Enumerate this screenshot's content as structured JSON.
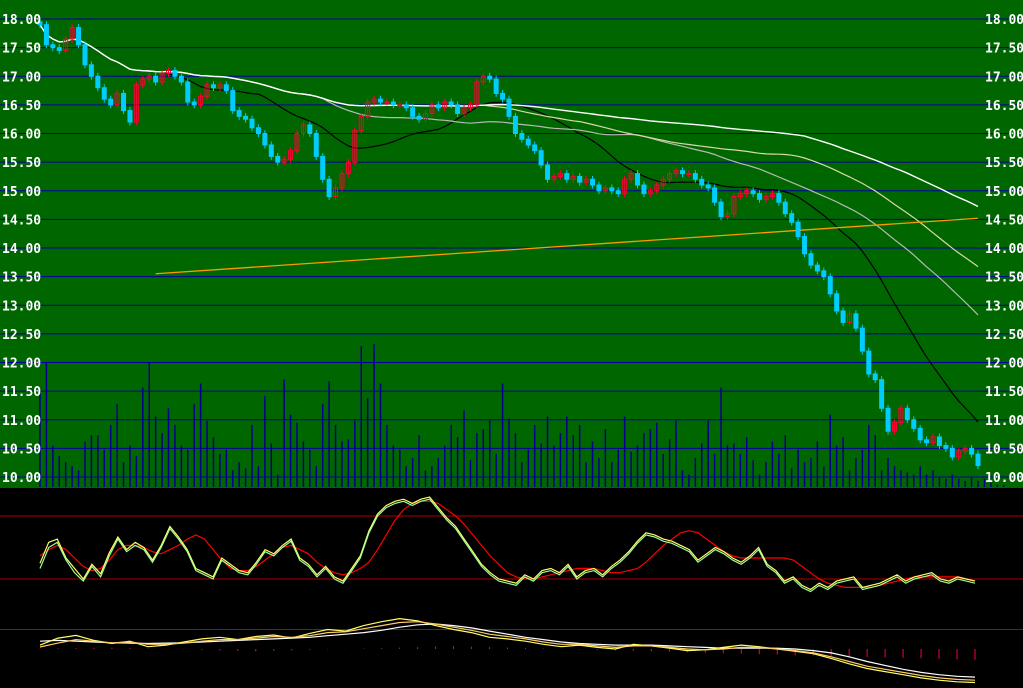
{
  "colors": {
    "main_background": "#006600",
    "indicator_background": "#000000",
    "grid": "#0000a0",
    "axis_text": "#ffffff",
    "up_candle": "#ff0033",
    "down_candle": "#00ccff",
    "volume": "#000088",
    "ma_white": "#ffffff",
    "ma_black": "#000000",
    "ma_pale": "#d8d8a8",
    "ma_grey": "#b8b8b8",
    "trend_orange": "#ff9900",
    "box_magenta": "#ff00aa",
    "box_yellow": "#ffff00",
    "kdj_red": "#ff0000",
    "kdj_yellow": "#ffff66",
    "kdj_green": "#99ff99",
    "ref_line": "#b00000"
  },
  "chart_data": [
    {
      "type": "candlestick",
      "title": "",
      "ylim": [
        10.0,
        18.0
      ],
      "grid": true,
      "y_ticks": [
        "18.00",
        "17.50",
        "17.00",
        "16.50",
        "16.00",
        "15.50",
        "15.00",
        "14.50",
        "14.00",
        "13.50",
        "13.00",
        "12.50",
        "12.00",
        "11.50",
        "11.00",
        "10.50",
        "10.00"
      ],
      "close": [
        17.9,
        17.55,
        17.5,
        17.45,
        17.65,
        17.85,
        17.55,
        17.2,
        17.0,
        16.8,
        16.6,
        16.5,
        16.7,
        16.4,
        16.2,
        16.85,
        16.95,
        17.0,
        16.9,
        17.05,
        17.1,
        17.0,
        16.9,
        16.55,
        16.5,
        16.65,
        16.85,
        16.8,
        16.85,
        16.75,
        16.4,
        16.3,
        16.25,
        16.1,
        16.0,
        15.8,
        15.6,
        15.5,
        15.55,
        15.7,
        16.0,
        16.15,
        16.0,
        15.6,
        15.2,
        14.9,
        15.05,
        15.3,
        15.5,
        16.05,
        16.3,
        16.55,
        16.6,
        16.55,
        16.55,
        16.5,
        16.5,
        16.45,
        16.3,
        16.25,
        16.35,
        16.5,
        16.45,
        16.55,
        16.5,
        16.35,
        16.45,
        16.5,
        16.9,
        17.0,
        16.95,
        16.7,
        16.6,
        16.3,
        16.0,
        15.9,
        15.8,
        15.7,
        15.45,
        15.2,
        15.25,
        15.3,
        15.2,
        15.25,
        15.15,
        15.2,
        15.1,
        15.0,
        15.05,
        15.0,
        14.95,
        15.2,
        15.3,
        15.1,
        14.95,
        15.0,
        15.1,
        15.2,
        15.3,
        15.35,
        15.3,
        15.3,
        15.2,
        15.1,
        15.05,
        14.8,
        14.55,
        14.6,
        14.9,
        14.95,
        15.0,
        14.95,
        14.85,
        14.9,
        14.95,
        14.8,
        14.6,
        14.45,
        14.2,
        13.9,
        13.7,
        13.6,
        13.5,
        13.2,
        12.9,
        12.7,
        12.85,
        12.6,
        12.2,
        11.8,
        11.7,
        11.2,
        10.8,
        10.95,
        11.2,
        11.0,
        10.85,
        10.65,
        10.6,
        10.7,
        10.55,
        10.5,
        10.35,
        10.45,
        10.5,
        10.4,
        10.2
      ],
      "volume_scale_max": 100,
      "volume": [
        45,
        60,
        20,
        15,
        12,
        10,
        8,
        22,
        25,
        25,
        18,
        30,
        40,
        12,
        20,
        15,
        48,
        60,
        34,
        26,
        38,
        30,
        20,
        18,
        40,
        50,
        32,
        24,
        16,
        18,
        8,
        12,
        9,
        30,
        10,
        44,
        21,
        6,
        52,
        35,
        31,
        22,
        18,
        10,
        40,
        51,
        30,
        22,
        23,
        32,
        68,
        43,
        69,
        50,
        30,
        20,
        18,
        10,
        14,
        25,
        8,
        10,
        14,
        20,
        30,
        24,
        37,
        13,
        26,
        28,
        32,
        16,
        50,
        33,
        26,
        12,
        18,
        30,
        21,
        34,
        20,
        26,
        34,
        25,
        30,
        12,
        22,
        14,
        28,
        12,
        18,
        34,
        17,
        20,
        26,
        28,
        31,
        16,
        23,
        32,
        8,
        6,
        14,
        21,
        32,
        16,
        48,
        20,
        21,
        16,
        24,
        13,
        6,
        12,
        22,
        16,
        25,
        9,
        18,
        12,
        14,
        22,
        10,
        35,
        20,
        24,
        8,
        14,
        18,
        30,
        25,
        8,
        14,
        10,
        8,
        7,
        6,
        10,
        6,
        8,
        5,
        4,
        6,
        4,
        3,
        5,
        3,
        4,
        2,
        1,
        1
      ]
    },
    {
      "type": "line",
      "title": "",
      "ylim": [
        0,
        100
      ],
      "ref_levels": [
        80,
        20
      ],
      "series": [
        {
          "color": "#ff0000",
          "values": [
            42,
            48,
            52,
            48,
            40,
            32,
            28,
            30,
            38,
            48,
            52,
            52,
            50,
            46,
            44,
            48,
            52,
            58,
            62,
            58,
            48,
            38,
            30,
            28,
            28,
            32,
            38,
            44,
            50,
            52,
            48,
            44,
            36,
            30,
            26,
            24,
            26,
            30,
            36,
            48,
            62,
            76,
            86,
            92,
            94,
            94,
            92,
            86,
            80,
            72,
            62,
            52,
            42,
            34,
            26,
            22,
            20,
            20,
            22,
            24,
            26,
            28,
            30,
            30,
            30,
            28,
            26,
            26,
            28,
            30,
            36,
            44,
            52,
            58,
            64,
            66,
            64,
            58,
            52,
            46,
            42,
            40,
            40,
            40,
            40,
            40,
            40,
            38,
            32,
            26,
            20,
            16,
            14,
            12,
            12,
            12,
            12,
            14,
            16,
            18,
            20,
            22,
            22,
            22,
            22,
            22,
            22,
            20,
            18
          ]
        },
        {
          "color": "#ffff66",
          "values": [
            35,
            55,
            58,
            40,
            30,
            20,
            34,
            25,
            45,
            60,
            48,
            55,
            50,
            38,
            52,
            70,
            60,
            48,
            30,
            26,
            22,
            40,
            34,
            28,
            26,
            36,
            48,
            44,
            52,
            58,
            40,
            34,
            24,
            32,
            22,
            18,
            30,
            42,
            66,
            82,
            90,
            94,
            96,
            92,
            96,
            98,
            88,
            78,
            70,
            58,
            46,
            34,
            26,
            20,
            18,
            16,
            24,
            20,
            28,
            30,
            26,
            34,
            22,
            28,
            30,
            24,
            32,
            38,
            46,
            56,
            64,
            62,
            58,
            56,
            52,
            48,
            38,
            44,
            50,
            46,
            40,
            36,
            42,
            50,
            34,
            28,
            18,
            22,
            14,
            10,
            16,
            12,
            18,
            20,
            22,
            12,
            14,
            16,
            20,
            24,
            18,
            22,
            24,
            26,
            20,
            18,
            22,
            20,
            18
          ]
        },
        {
          "color": "#99ff99",
          "values": [
            30,
            50,
            55,
            38,
            26,
            18,
            32,
            22,
            42,
            58,
            46,
            52,
            48,
            36,
            50,
            68,
            58,
            46,
            28,
            24,
            20,
            38,
            32,
            26,
            24,
            34,
            46,
            42,
            50,
            56,
            38,
            32,
            22,
            30,
            20,
            16,
            28,
            40,
            64,
            80,
            88,
            92,
            94,
            90,
            94,
            96,
            86,
            76,
            68,
            56,
            44,
            32,
            24,
            18,
            16,
            14,
            22,
            18,
            26,
            28,
            24,
            32,
            20,
            26,
            28,
            22,
            30,
            36,
            44,
            54,
            62,
            60,
            56,
            54,
            50,
            46,
            36,
            42,
            48,
            44,
            38,
            34,
            40,
            48,
            32,
            26,
            16,
            20,
            12,
            8,
            14,
            10,
            16,
            18,
            20,
            10,
            12,
            14,
            18,
            22,
            16,
            20,
            22,
            24,
            18,
            16,
            20,
            18,
            16
          ]
        }
      ]
    },
    {
      "type": "line",
      "title": "",
      "ylim": [
        -100,
        100
      ],
      "ref_levels": [
        50
      ],
      "series": [
        {
          "color": "#ffffff",
          "values": [
            20,
            22,
            20,
            18,
            16,
            15,
            14,
            15,
            16,
            18,
            20,
            22,
            24,
            26,
            28,
            30,
            34,
            38,
            42,
            48,
            56,
            62,
            64,
            60,
            54,
            46,
            38,
            30,
            24,
            18,
            14,
            12,
            10,
            10,
            10,
            8,
            6,
            4,
            2,
            2,
            2,
            2,
            0,
            -4,
            -10,
            -20,
            -32,
            -42,
            -52,
            -60,
            -66,
            -70,
            -72
          ]
        },
        {
          "color": "#ffff66",
          "values": [
            10,
            28,
            35,
            22,
            14,
            20,
            6,
            10,
            18,
            26,
            30,
            24,
            32,
            36,
            28,
            40,
            50,
            46,
            60,
            70,
            78,
            72,
            60,
            50,
            42,
            30,
            26,
            20,
            12,
            6,
            10,
            4,
            0,
            12,
            8,
            2,
            -4,
            -2,
            4,
            10,
            6,
            0,
            -6,
            -12,
            -24,
            -38,
            -50,
            -58,
            -66,
            -74,
            -80,
            -84,
            -86
          ]
        },
        {
          "color": "#ffcc66",
          "values": [
            5,
            15,
            24,
            20,
            16,
            18,
            12,
            12,
            15,
            20,
            24,
            24,
            28,
            32,
            30,
            34,
            42,
            44,
            52,
            60,
            68,
            70,
            64,
            56,
            48,
            38,
            32,
            26,
            18,
            12,
            12,
            8,
            4,
            8,
            8,
            4,
            0,
            -2,
            0,
            4,
            4,
            0,
            -4,
            -10,
            -20,
            -32,
            -44,
            -52,
            -60,
            -68,
            -74,
            -78,
            -80
          ]
        }
      ],
      "histogram": [
        2,
        3,
        4,
        5,
        6,
        4,
        2,
        1,
        -2,
        -4,
        -6,
        -8,
        -10,
        -8,
        -6,
        -4,
        -2,
        -1,
        2,
        4,
        6,
        8,
        10,
        12,
        10,
        8,
        6,
        4,
        2,
        1,
        -2,
        -4,
        -6,
        -8,
        -10,
        -12,
        -14,
        -16,
        -18,
        -20,
        -22,
        -24,
        -26,
        -28,
        -30,
        -32,
        -34,
        -36,
        -38,
        -40,
        -42,
        -44,
        -46
      ]
    }
  ]
}
